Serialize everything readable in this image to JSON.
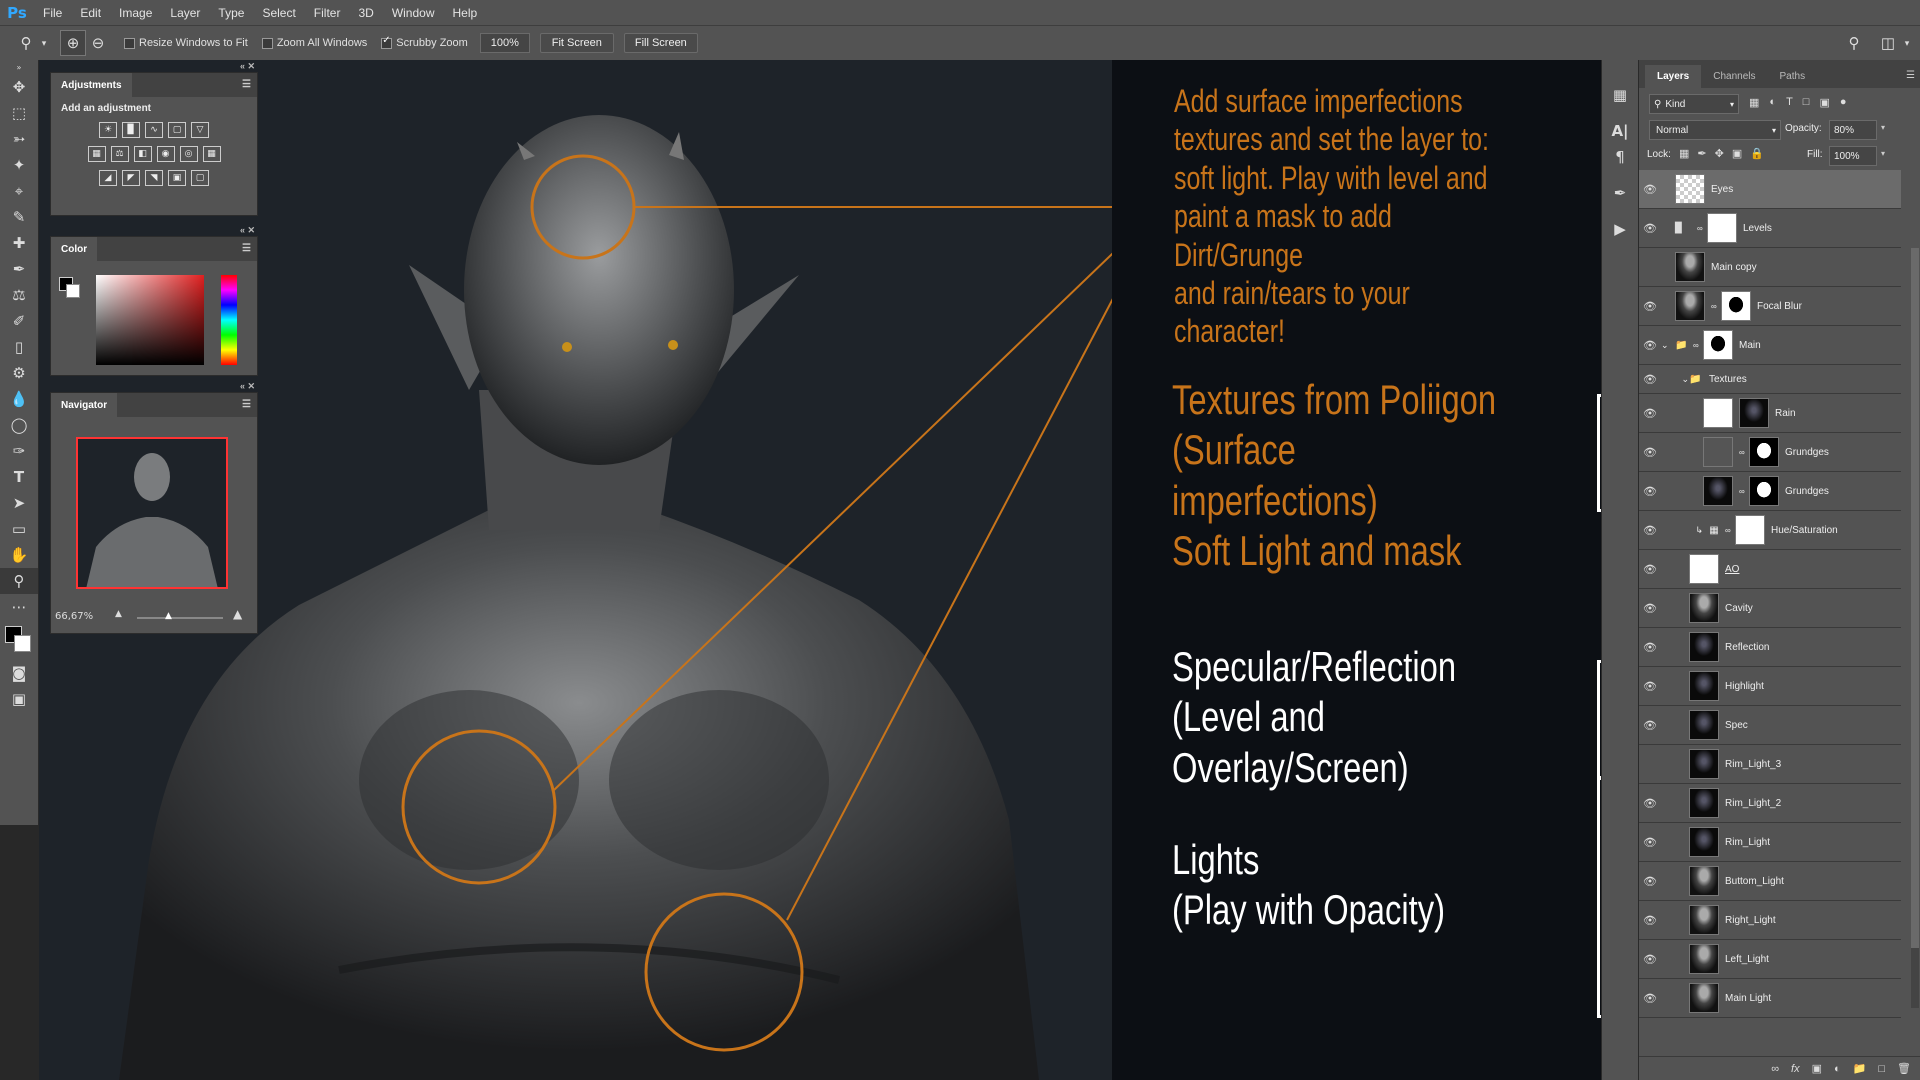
{
  "app": {
    "logo": "Ps"
  },
  "menu": [
    "File",
    "Edit",
    "Image",
    "Layer",
    "Type",
    "Select",
    "Filter",
    "3D",
    "Window",
    "Help"
  ],
  "options": {
    "resize_windows": "Resize Windows to Fit",
    "zoom_all": "Zoom All Windows",
    "scrubby": "Scrubby Zoom",
    "zoom_value": "100%",
    "fit_screen": "Fit Screen",
    "fill_screen": "Fill Screen"
  },
  "adjustments": {
    "title": "Adjustments",
    "subtitle": "Add an adjustment"
  },
  "color_panel": {
    "title": "Color"
  },
  "navigator": {
    "title": "Navigator",
    "zoom": "66,67%"
  },
  "notes": {
    "n1": "Add surface imperfections\ntextures and set the layer to:\nsoft light. Play with level and\npaint a mask to add Dirt/Grunge\nand rain/tears to your\ncharacter!",
    "n2": "Textures from Poliigon\n(Surface imperfections)\nSoft Light and mask",
    "n3": "Specular/Reflection\n(Level and Overlay/Screen)",
    "n4": "Lights\n(Play with Opacity)"
  },
  "colors": {
    "orange": "#c8741a",
    "white": "#ffffff",
    "accent": "#31a8ff"
  },
  "layers_panel": {
    "tabs": [
      "Layers",
      "Channels",
      "Paths"
    ],
    "kind": "Kind",
    "blend_mode": "Normal",
    "opacity_label": "Opacity:",
    "opacity": "80%",
    "lock_label": "Lock:",
    "fill_label": "Fill:",
    "fill": "100%",
    "layers": [
      {
        "name": "Eyes"
      },
      {
        "name": "Levels"
      },
      {
        "name": "Main copy"
      },
      {
        "name": "Focal Blur"
      },
      {
        "name": "Main"
      },
      {
        "name": "Textures"
      },
      {
        "name": "Rain"
      },
      {
        "name": "Grundges"
      },
      {
        "name": "Grundges"
      },
      {
        "name": "Hue/Saturation"
      },
      {
        "name": "AO"
      },
      {
        "name": "Cavity"
      },
      {
        "name": "Reflection"
      },
      {
        "name": "Highlight"
      },
      {
        "name": "Spec"
      },
      {
        "name": "Rim_Light_3"
      },
      {
        "name": "Rim_Light_2"
      },
      {
        "name": "Rim_Light"
      },
      {
        "name": "Buttom_Light"
      },
      {
        "name": "Right_Light"
      },
      {
        "name": "Left_Light"
      },
      {
        "name": "Main Light"
      }
    ]
  }
}
